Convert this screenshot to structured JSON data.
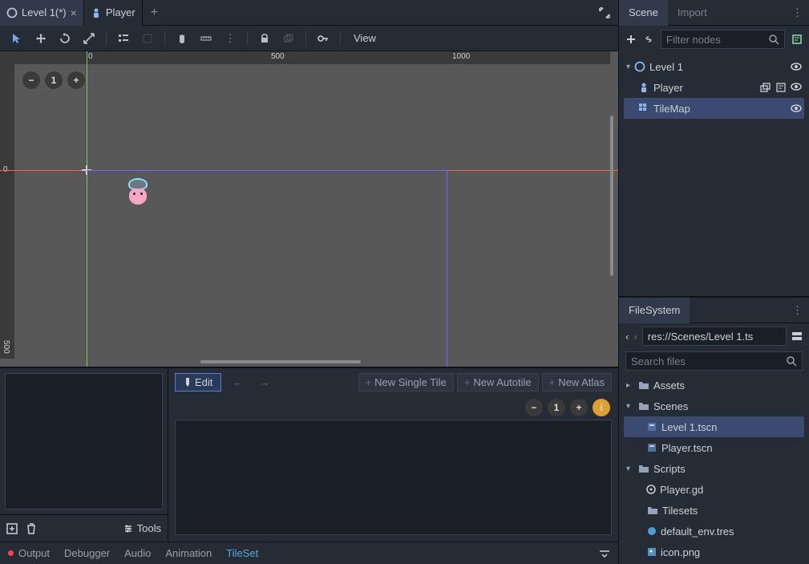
{
  "scene_tabs": {
    "tab0_label": "Level 1(*)",
    "tab1_label": "Player"
  },
  "toolbar": {
    "view_label": "View",
    "select_mode": "Select Mode"
  },
  "ruler": {
    "h0": "0",
    "h500": "500",
    "h1000": "1000",
    "v0": "0",
    "v500": "500"
  },
  "zoom": {
    "out": "−",
    "reset": "1",
    "in": "+"
  },
  "tileset": {
    "edit_label": "Edit",
    "new_single_tile": "New Single Tile",
    "new_autotile": "New Autotile",
    "new_atlas": "New Atlas",
    "tools_label": "Tools",
    "zoom_out": "−",
    "zoom_reset": "1",
    "zoom_in": "+"
  },
  "status": {
    "output": "Output",
    "debugger": "Debugger",
    "audio": "Audio",
    "animation": "Animation",
    "tileset": "TileSet"
  },
  "scene_dock": {
    "tab_scene": "Scene",
    "tab_import": "Import",
    "filter_placeholder": "Filter nodes",
    "tree": {
      "root": "Level 1",
      "player": "Player",
      "tilemap": "TileMap"
    }
  },
  "filesystem": {
    "title": "FileSystem",
    "path": "res://Scenes/Level 1.ts",
    "search_placeholder": "Search files",
    "tree": {
      "assets": "Assets",
      "scenes": "Scenes",
      "level1": "Level 1.tscn",
      "player_tscn": "Player.tscn",
      "scripts": "Scripts",
      "player_gd": "Player.gd",
      "tilesets": "Tilesets",
      "default_env": "default_env.tres",
      "icon_png": "icon.png"
    }
  }
}
